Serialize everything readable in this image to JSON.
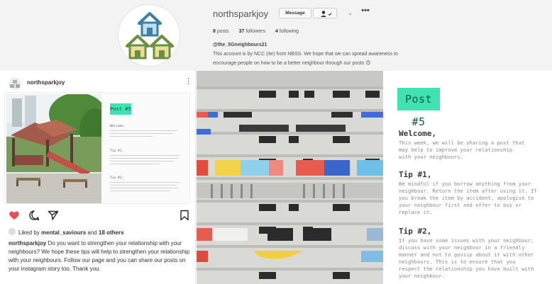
{
  "profile": {
    "username": "northsparkjoy",
    "message_label": "Message",
    "more_label": "•••",
    "stats": [
      {
        "count": "8",
        "label": "posts"
      },
      {
        "count": "37",
        "label": "followers"
      },
      {
        "count": "4",
        "label": "following"
      }
    ],
    "bio_name": "@the_5Gneighbours21",
    "bio_line_1": "This account is by NCC (4e) from NBSS. We hope that we can spread awareness to",
    "bio_line_2": "encourage people on how to be a better neighbour through our posts 😊"
  },
  "post": {
    "author": "northsparkjoy",
    "mini_title": "Post #5",
    "mini_welcome": "Welcome,",
    "mini_tip1": "Tip #1,",
    "mini_tip2": "Tip #2,",
    "liked_by_prefix": "Liked by",
    "liked_by_user": "mental_saviours",
    "liked_by_and": "and",
    "liked_by_others": "18 others",
    "caption_user": "northsparkjoy",
    "caption_text": "Do you want to strengthen your relationship with your neighbours? We hope these tips will help to strengthen your relationship with your neighbours. Follow our page and you can share our posts on your instagram story too. Thank you."
  },
  "panel": {
    "title": "Post #5",
    "welcome_head": "Welcome,",
    "welcome_body": "This week, we will be sharing a post that\nmay help to improve your relationship\nwith your neighbours.",
    "tip1_head": "Tip #1,",
    "tip1_body": "Be mindful if you borrow anything from your\nneighbour. Return the item after using it. If\nyou break the item by accident, apologise to\nyour neighbour first and offer to buy or\nreplace it.",
    "tip2_head": "Tip #2,",
    "tip2_body": "If you have some issues with your neighbour,\ndiscuss with your neighbour in a friendly\nmanner and not to gossip about it with other\nneighbours. This is to ensure that you\nrespect the relationship you have built with\nyour neighbour."
  },
  "colors": {
    "accent_title_bg": "#3fe2b0",
    "like_heart": "#ed4956",
    "house_blue": "#3d7fa6",
    "house_green": "#6b8f3e"
  }
}
